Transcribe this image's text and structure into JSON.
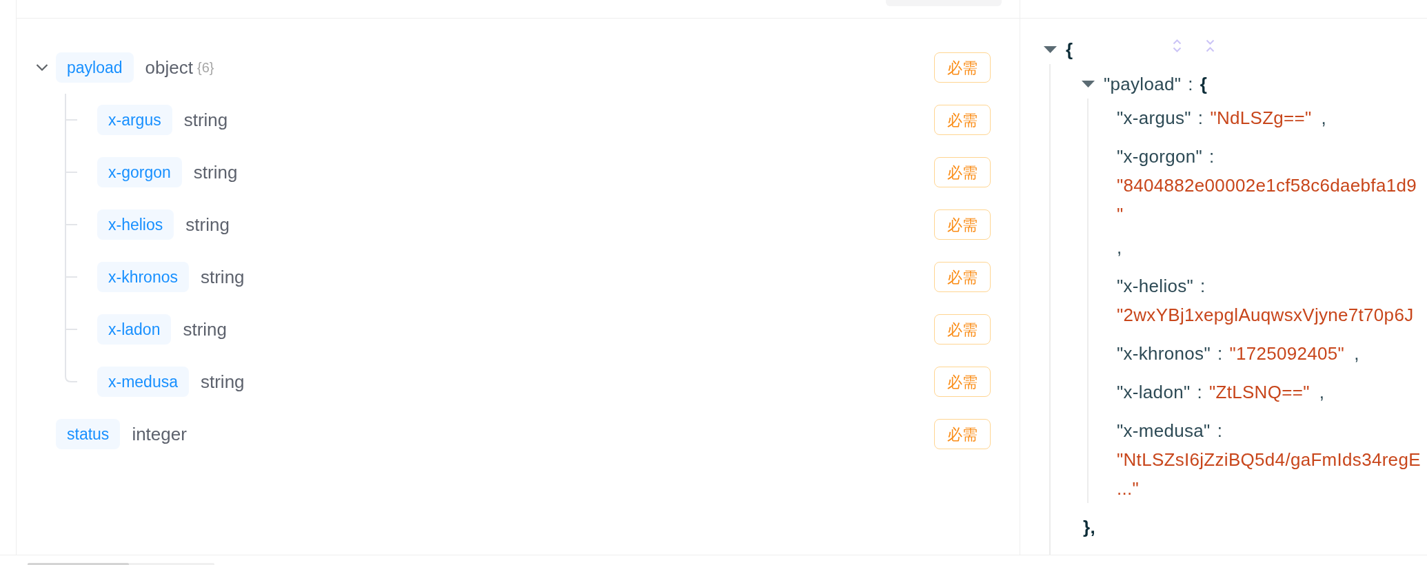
{
  "left_panel": {
    "schema_tree": [
      {
        "name": "payload",
        "type": "object",
        "count": "{6}",
        "expanded": true,
        "required_label": "必需",
        "children": [
          {
            "name": "x-argus",
            "type": "string",
            "required_label": "必需"
          },
          {
            "name": "x-gorgon",
            "type": "string",
            "required_label": "必需"
          },
          {
            "name": "x-helios",
            "type": "string",
            "required_label": "必需"
          },
          {
            "name": "x-khronos",
            "type": "string",
            "required_label": "必需"
          },
          {
            "name": "x-ladon",
            "type": "string",
            "required_label": "必需"
          },
          {
            "name": "x-medusa",
            "type": "string",
            "required_label": "必需"
          }
        ]
      },
      {
        "name": "status",
        "type": "integer",
        "required_label": "必需"
      }
    ]
  },
  "right_panel": {
    "json_viewer": {
      "open": "{",
      "expanded": true,
      "children": [
        {
          "key": "\"payload\"",
          "colon": ":",
          "open": "{",
          "expanded": true,
          "close": "},",
          "children": [
            {
              "kind": "inline",
              "key": "\"x-argus\"",
              "colon": ":",
              "value_lines": [
                "\"NdLSZg==\""
              ],
              "comma": ","
            },
            {
              "kind": "wrapped",
              "key": "\"x-gorgon\"",
              "colon": ":",
              "value_lines": [
                "\"8404882e00002e1cf58c6daebfa1d9",
                "\""
              ],
              "comma": ","
            },
            {
              "kind": "wrapped",
              "key": "\"x-helios\"",
              "colon": ":",
              "value_lines": [
                "\"2wxYBj1xepglAuqwsxVjyne7t70p6J"
              ]
            },
            {
              "kind": "inline",
              "key": "\"x-khronos\"",
              "colon": ":",
              "value_lines": [
                "\"1725092405\""
              ],
              "comma": ","
            },
            {
              "kind": "inline",
              "key": "\"x-ladon\"",
              "colon": ":",
              "value_lines": [
                "\"ZtLSNQ==\""
              ],
              "comma": ","
            },
            {
              "kind": "wrapped",
              "key": "\"x-medusa\"",
              "colon": ":",
              "value_lines": [
                "\"NtLSZsI6jZziBQ5d4/gaFmIds34regE",
                "...\""
              ]
            }
          ]
        }
      ]
    }
  }
}
